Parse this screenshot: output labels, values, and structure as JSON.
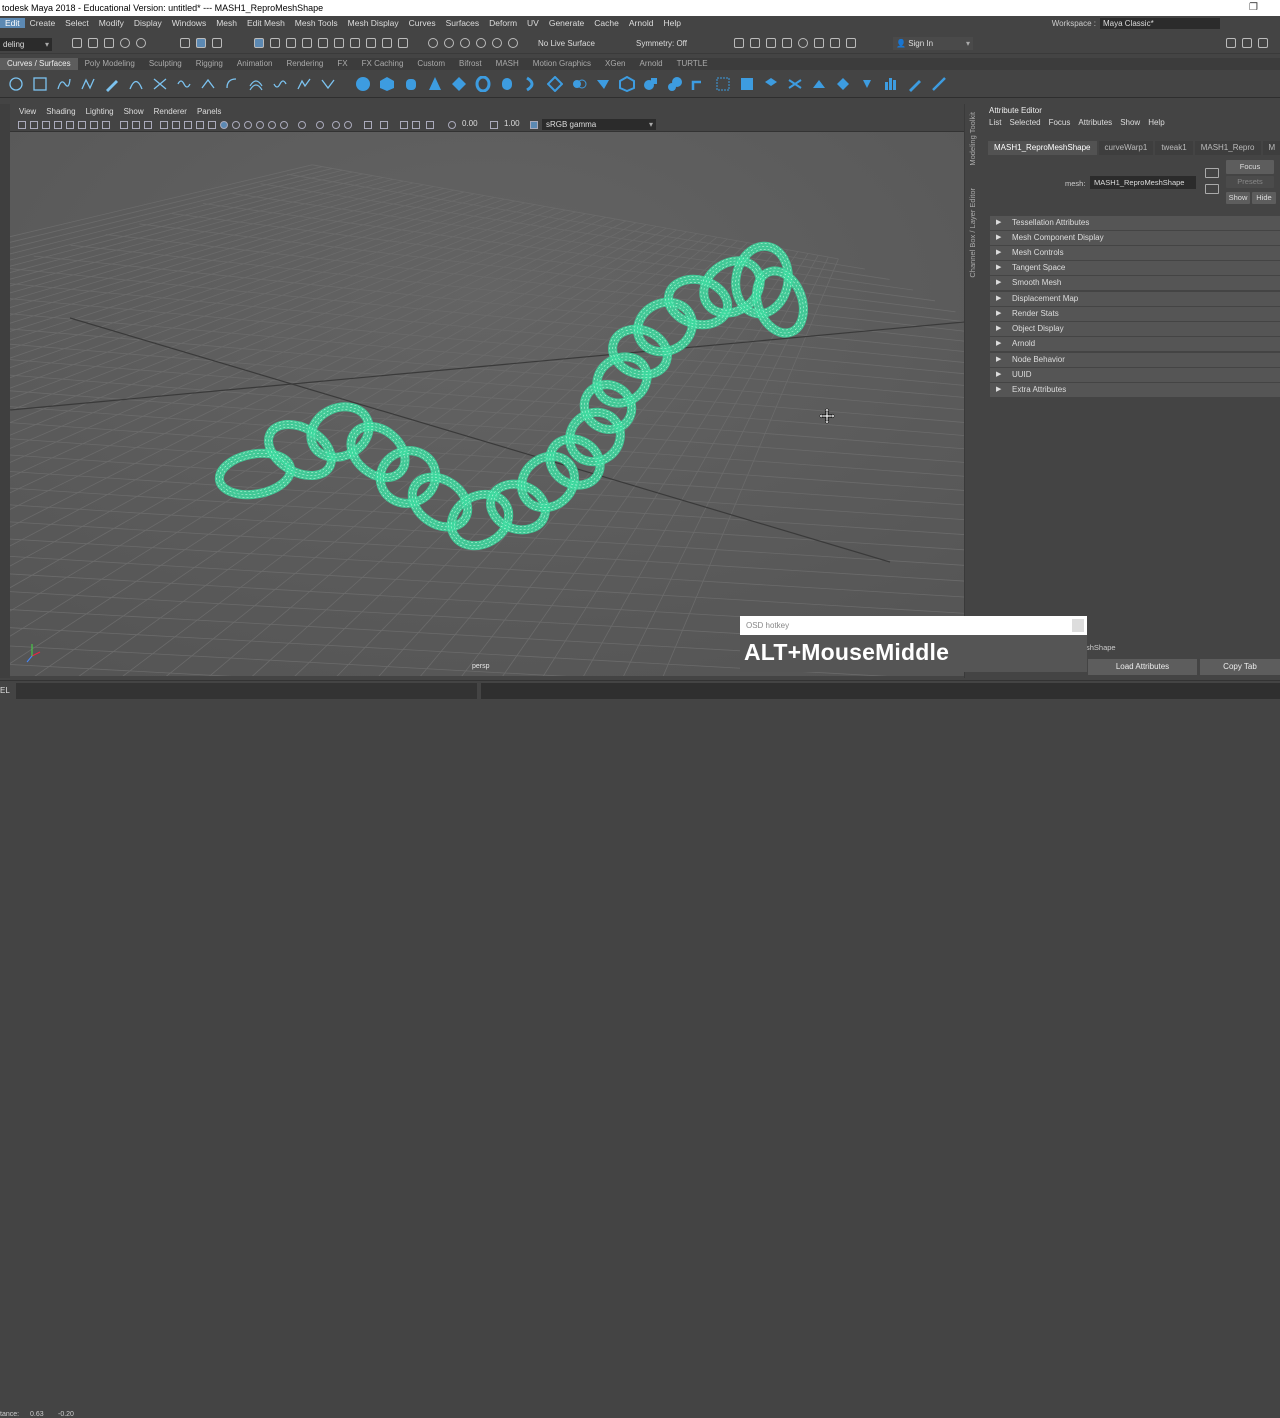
{
  "window": {
    "title": "todesk Maya 2018 - Educational Version: untitled*   ---   MASH1_ReproMeshShape"
  },
  "menubar": [
    "Edit",
    "Create",
    "Select",
    "Modify",
    "Display",
    "Windows",
    "Mesh",
    "Edit Mesh",
    "Mesh Tools",
    "Mesh Display",
    "Curves",
    "Surfaces",
    "Deform",
    "UV",
    "Generate",
    "Cache",
    "Arnold",
    "Help"
  ],
  "workspace": {
    "label": "Workspace :",
    "value": "Maya Classic*"
  },
  "statusline": {
    "mode": "deling",
    "live_surface": "No Live Surface",
    "symmetry": "Symmetry: Off",
    "sign_in": "Sign In"
  },
  "shelf_tabs": [
    "Curves / Surfaces",
    "Poly Modeling",
    "Sculpting",
    "Rigging",
    "Animation",
    "Rendering",
    "FX",
    "FX Caching",
    "Custom",
    "Bifrost",
    "MASH",
    "Motion Graphics",
    "XGen",
    "Arnold",
    "TURTLE"
  ],
  "viewport": {
    "menu": [
      "View",
      "Shading",
      "Lighting",
      "Show",
      "Renderer",
      "Panels"
    ],
    "value_a": "0.00",
    "value_b": "1.00",
    "color_space": "sRGB gamma",
    "camera": "persp"
  },
  "side_tabs": {
    "a": "Modeling Toolkit",
    "b": "Channel Box / Layer Editor"
  },
  "attribute_editor": {
    "title": "Attribute Editor",
    "menu": [
      "List",
      "Selected",
      "Focus",
      "Attributes",
      "Show",
      "Help"
    ],
    "tabs": [
      "MASH1_ReproMeshShape",
      "curveWarp1",
      "tweak1",
      "MASH1_Repro",
      "M"
    ],
    "mesh_label": "mesh:",
    "mesh_value": "MASH1_ReproMeshShape",
    "focus": "Focus",
    "presets": "Presets",
    "show": "Show",
    "hide": "Hide",
    "sections": [
      "Tessellation Attributes",
      "Mesh Component Display",
      "Mesh Controls",
      "Tangent Space",
      "Smooth Mesh",
      "Displacement Map",
      "Render Stats",
      "Object Display",
      "Arnold",
      "Node Behavior",
      "UUID",
      "Extra Attributes"
    ],
    "bottom_field": "shShape",
    "load_attributes": "Load Attributes",
    "copy_tab": "Copy Tab"
  },
  "cmdline": {
    "label": "EL"
  },
  "helpline": {
    "label": "tance:",
    "v1": "0.63",
    "v2": "-0.20"
  },
  "osd": {
    "title": "OSD hotkey",
    "text": "ALT+MouseMiddle"
  },
  "colors": {
    "accent": "#5c89b3",
    "mesh": "#3ddba0"
  }
}
